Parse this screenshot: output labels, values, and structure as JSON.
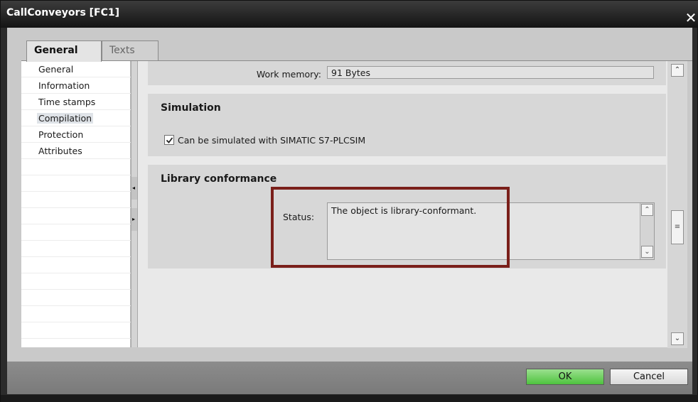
{
  "window": {
    "title": "CallConveyors [FC1]",
    "close_glyph": "✕"
  },
  "tabs": [
    {
      "label": "General",
      "active": true
    },
    {
      "label": "Texts",
      "active": false
    }
  ],
  "nav": {
    "items": [
      {
        "label": "General"
      },
      {
        "label": "Information"
      },
      {
        "label": "Time stamps"
      },
      {
        "label": "Compilation",
        "selected": true
      },
      {
        "label": "Protection"
      },
      {
        "label": "Attributes"
      }
    ]
  },
  "work_memory": {
    "label": "Work memory:",
    "value": "91 Bytes"
  },
  "simulation": {
    "title": "Simulation",
    "checkbox_label": "Can be simulated with SIMATIC S7-PLCSIM",
    "checked": true
  },
  "library": {
    "title": "Library conformance",
    "status_label": "Status:",
    "status_value": "The object is library-conformant."
  },
  "buttons": {
    "ok": "OK",
    "cancel": "Cancel"
  },
  "colors": {
    "highlight": "#7a1f1a",
    "ok_green": "#4ec33e",
    "titlebar": "#141414"
  }
}
